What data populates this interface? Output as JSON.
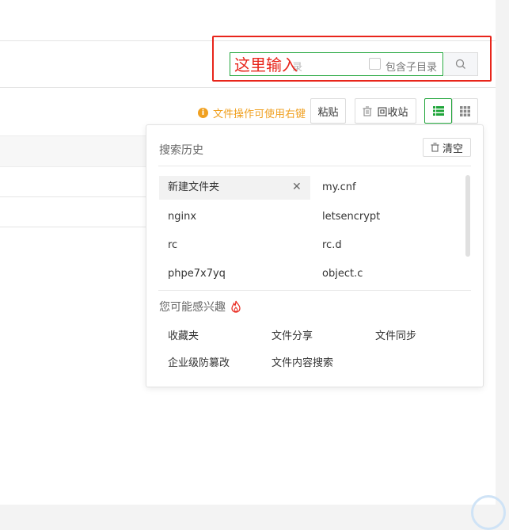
{
  "search": {
    "placeholder_partial": "录",
    "annotation": "这里输入",
    "include_subdir_label": "包含子目录"
  },
  "toolbar": {
    "tip": "文件操作可使用右键",
    "paste_label": "粘贴",
    "recycle_label": "回收站"
  },
  "dropdown": {
    "history_title": "搜索历史",
    "clear_label": "清空",
    "history": [
      "新建文件夹",
      "my.cnf",
      "nginx",
      "letsencrypt",
      "rc",
      "rc.d",
      "phpe7x7yq",
      "object.c"
    ],
    "interest_title": "您可能感兴趣",
    "interests": [
      "收藏夹",
      "文件分享",
      "文件同步",
      "企业级防篡改",
      "文件内容搜索"
    ]
  },
  "colors": {
    "accent": "#20a53a",
    "annotation": "#e8251b",
    "tip": "#f0a020"
  }
}
